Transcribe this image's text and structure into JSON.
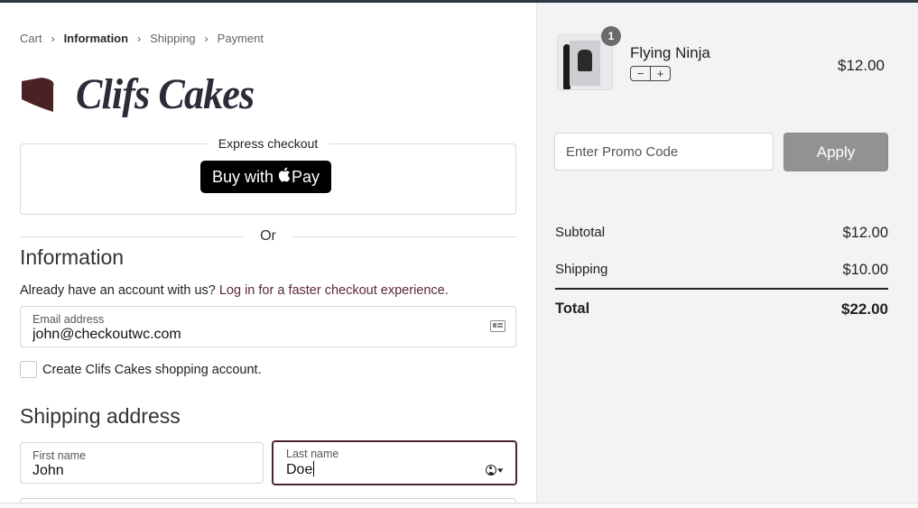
{
  "breadcrumb": {
    "items": [
      "Cart",
      "Information",
      "Shipping",
      "Payment"
    ],
    "separator": "›",
    "active_index": 1
  },
  "brand": {
    "name": "Clifs Cakes",
    "logo_mark_color": "#4a2226"
  },
  "express_checkout": {
    "label": "Express checkout",
    "applepay_prefix": "Buy with",
    "applepay_glyph": "",
    "applepay_suffix": "Pay"
  },
  "divider": {
    "or_label": "Or"
  },
  "information": {
    "title": "Information",
    "login_prompt": "Already have an account with us?",
    "login_link": "Log in for a faster checkout experience."
  },
  "email_field": {
    "label": "Email address",
    "value": "john@checkoutwc.com",
    "icon": "contact-card-icon"
  },
  "create_account": {
    "label": "Create Clifs Cakes shopping account.",
    "checked": false
  },
  "shipping_address": {
    "title": "Shipping address",
    "first_name": {
      "label": "First name",
      "value": "John"
    },
    "last_name": {
      "label": "Last name",
      "value": "Doe",
      "focused": true,
      "icon": "autofill-contact-icon"
    }
  },
  "cart": {
    "item": {
      "name": "Flying Ninja",
      "quantity": "1",
      "decrement_label": "−",
      "increment_label": "+",
      "price": "$12.00"
    },
    "promo": {
      "placeholder": "Enter Promo Code",
      "apply_label": "Apply"
    },
    "totals": {
      "subtotal_label": "Subtotal",
      "subtotal_value": "$12.00",
      "shipping_label": "Shipping",
      "shipping_value": "$10.00",
      "total_label": "Total",
      "total_value": "$22.00"
    }
  },
  "colors": {
    "accent": "#5b2a35",
    "focus_border": "#4a2530",
    "sidebar_bg": "#f3f3f6",
    "apply_button": "#929292"
  }
}
